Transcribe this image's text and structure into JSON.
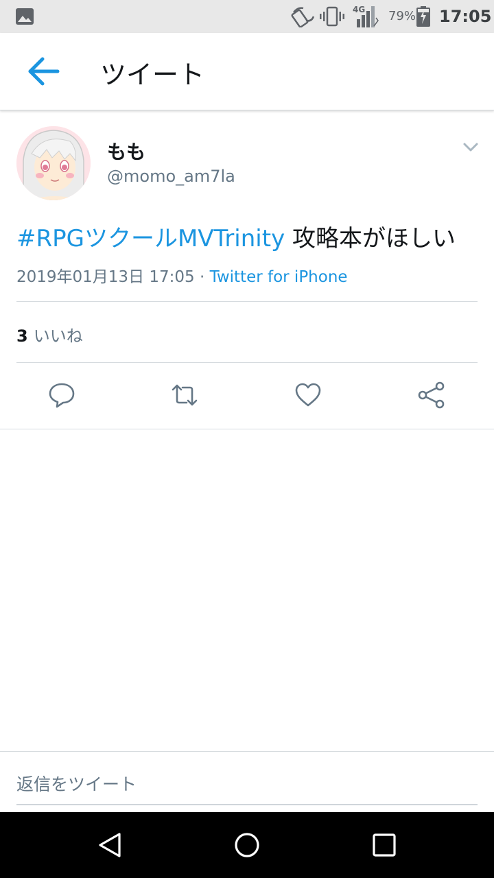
{
  "status_bar": {
    "battery_percent": "79%",
    "time": "17:05",
    "network": "4G",
    "icons": [
      "image-icon",
      "nfc-icon",
      "vibrate-icon",
      "signal-icon",
      "battery-icon"
    ]
  },
  "app_bar": {
    "title": "ツイート",
    "back_icon": "arrow-left-icon"
  },
  "tweet": {
    "display_name": "もも",
    "handle": "@momo_am7la",
    "hashtag": "#RPGツクールMVTrinity",
    "text": " 攻略本がほしい",
    "timestamp": "2019年01月13日 17:05 · ",
    "source": "Twitter for iPhone",
    "likes_count": "3",
    "likes_label": "いいね"
  },
  "actions": [
    "reply-icon",
    "retweet-icon",
    "like-icon",
    "share-icon"
  ],
  "reply": {
    "placeholder": "返信をツイート"
  },
  "navigation": [
    "back-triangle-icon",
    "home-circle-icon",
    "recents-square-icon"
  ],
  "colors": {
    "accent": "#1b95e0",
    "text_primary": "#14171a",
    "text_secondary": "#657786",
    "divider": "#d6dbdf",
    "status_bar_bg": "#e8e8e8",
    "nav_bar_bg": "#000000"
  }
}
